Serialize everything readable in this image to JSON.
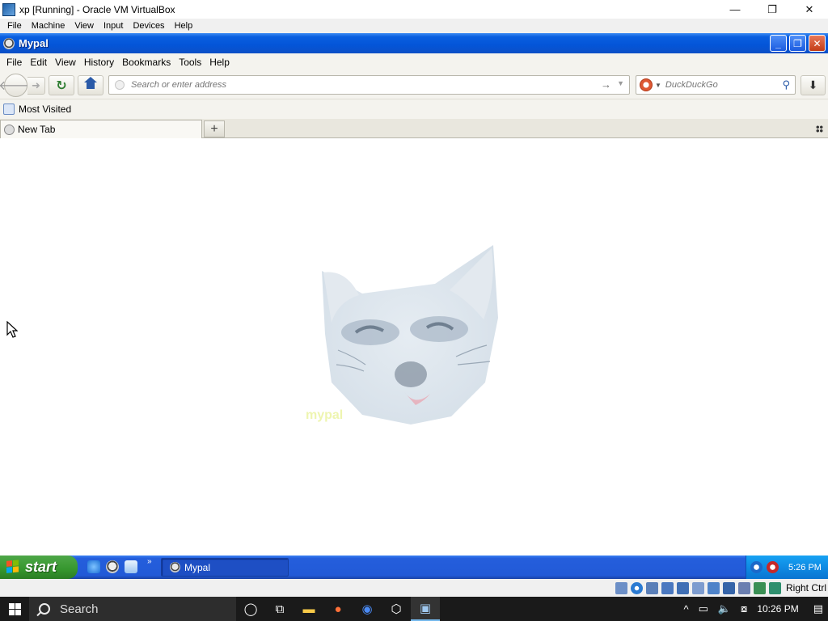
{
  "host_window": {
    "title": "xp [Running] - Oracle VM VirtualBox",
    "controls": [
      "—",
      "❐",
      "✕"
    ],
    "menu": [
      "File",
      "Machine",
      "View",
      "Input",
      "Devices",
      "Help"
    ]
  },
  "guest_window": {
    "title": "Mypal",
    "controls": [
      "_",
      "❐",
      "✕"
    ]
  },
  "browser": {
    "menu": [
      "File",
      "Edit",
      "View",
      "History",
      "Bookmarks",
      "Tools",
      "Help"
    ],
    "url_placeholder": "Search or enter address",
    "search_placeholder": "DuckDuckGo",
    "bookmarks_toolbar": {
      "most_visited": "Most Visited"
    },
    "tabs": [
      {
        "label": "New Tab"
      }
    ],
    "new_tab_symbol": "+"
  },
  "content": {
    "logo_text": "mypal"
  },
  "xp_taskbar": {
    "start_label": "start",
    "task_button": "Mypal",
    "clock": "5:26 PM",
    "chevron": "»"
  },
  "vbox_status": {
    "host_key": "Right Ctrl"
  },
  "win_taskbar": {
    "search_label": "Search",
    "clock": "10:26 PM"
  },
  "colors": {
    "xp_blue": "#0455d8",
    "xp_green": "#36962e",
    "tray_blue": "#0f8be3"
  }
}
